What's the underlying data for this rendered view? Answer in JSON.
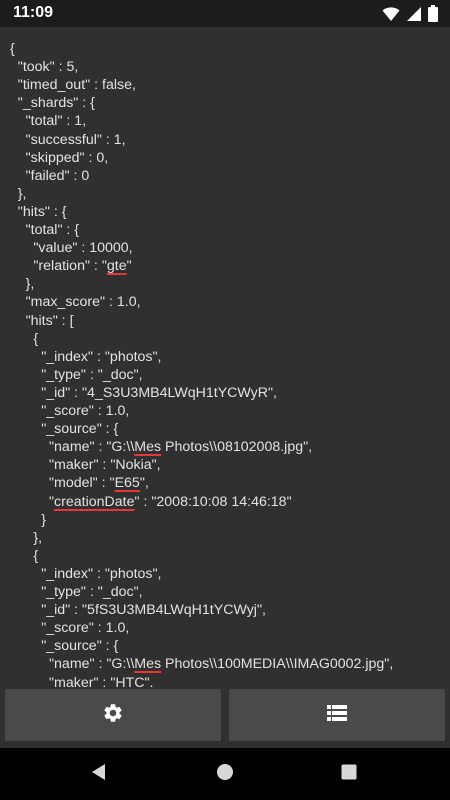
{
  "status": {
    "time": "11:09",
    "icons": [
      "wifi-icon",
      "signal-icon",
      "battery-icon"
    ]
  },
  "json_lines": [
    {
      "indent": 0,
      "parts": [
        {
          "t": "{"
        }
      ]
    },
    {
      "indent": 1,
      "parts": [
        {
          "t": "\"took\" : 5,"
        }
      ]
    },
    {
      "indent": 1,
      "parts": [
        {
          "t": "\"timed_out\" : false,"
        }
      ]
    },
    {
      "indent": 1,
      "parts": [
        {
          "t": "\"_shards\" : {"
        }
      ]
    },
    {
      "indent": 2,
      "parts": [
        {
          "t": "\"total\" : 1,"
        }
      ]
    },
    {
      "indent": 2,
      "parts": [
        {
          "t": "\"successful\" : 1,"
        }
      ]
    },
    {
      "indent": 2,
      "parts": [
        {
          "t": "\"skipped\" : 0,"
        }
      ]
    },
    {
      "indent": 2,
      "parts": [
        {
          "t": "\"failed\" : 0"
        }
      ]
    },
    {
      "indent": 1,
      "parts": [
        {
          "t": "},"
        }
      ]
    },
    {
      "indent": 1,
      "parts": [
        {
          "t": "\"hits\" : {"
        }
      ]
    },
    {
      "indent": 2,
      "parts": [
        {
          "t": "\"total\" : {"
        }
      ]
    },
    {
      "indent": 3,
      "parts": [
        {
          "t": "\"value\" : 10000,"
        }
      ]
    },
    {
      "indent": 3,
      "parts": [
        {
          "t": "\"relation\" : \""
        },
        {
          "t": "gte",
          "spell": true
        },
        {
          "t": "\""
        }
      ]
    },
    {
      "indent": 2,
      "parts": [
        {
          "t": "},"
        }
      ]
    },
    {
      "indent": 2,
      "parts": [
        {
          "t": "\"max_score\" : 1.0,"
        }
      ]
    },
    {
      "indent": 2,
      "parts": [
        {
          "t": "\"hits\" : ["
        }
      ]
    },
    {
      "indent": 3,
      "parts": [
        {
          "t": "{"
        }
      ]
    },
    {
      "indent": 4,
      "parts": [
        {
          "t": "\"_index\" : \"photos\","
        }
      ]
    },
    {
      "indent": 4,
      "parts": [
        {
          "t": "\"_type\" : \"_doc\","
        }
      ]
    },
    {
      "indent": 4,
      "parts": [
        {
          "t": "\"_id\" : \"4_S3U3MB4LWqH1tYCWyR\","
        }
      ]
    },
    {
      "indent": 4,
      "parts": [
        {
          "t": "\"_score\" : 1.0,"
        }
      ]
    },
    {
      "indent": 4,
      "parts": [
        {
          "t": "\"_source\" : {"
        }
      ]
    },
    {
      "indent": 5,
      "parts": [
        {
          "t": "\"name\" : \"G:\\\\"
        },
        {
          "t": "Mes",
          "spell": true
        },
        {
          "t": " Photos\\\\08102008.jpg\","
        }
      ]
    },
    {
      "indent": 5,
      "parts": [
        {
          "t": "\"maker\" : \"Nokia\","
        }
      ]
    },
    {
      "indent": 5,
      "parts": [
        {
          "t": "\"model\" : \""
        },
        {
          "t": "E65",
          "spell": true
        },
        {
          "t": "\","
        }
      ]
    },
    {
      "indent": 5,
      "parts": [
        {
          "t": "\""
        },
        {
          "t": "creationDate",
          "spell": true
        },
        {
          "t": "\" : \"2008:10:08 14:46:18\""
        }
      ]
    },
    {
      "indent": 4,
      "parts": [
        {
          "t": "}"
        }
      ]
    },
    {
      "indent": 3,
      "parts": [
        {
          "t": "},"
        }
      ]
    },
    {
      "indent": 3,
      "parts": [
        {
          "t": "{"
        }
      ]
    },
    {
      "indent": 4,
      "parts": [
        {
          "t": "\"_index\" : \"photos\","
        }
      ]
    },
    {
      "indent": 4,
      "parts": [
        {
          "t": "\"_type\" : \"_doc\","
        }
      ]
    },
    {
      "indent": 4,
      "parts": [
        {
          "t": "\"_id\" : \"5fS3U3MB4LWqH1tYCWyj\","
        }
      ]
    },
    {
      "indent": 4,
      "parts": [
        {
          "t": "\"_score\" : 1.0,"
        }
      ]
    },
    {
      "indent": 4,
      "parts": [
        {
          "t": "\"_source\" : {"
        }
      ]
    },
    {
      "indent": 5,
      "parts": [
        {
          "t": "\"name\" : \"G:\\\\"
        },
        {
          "t": "Mes",
          "spell": true
        },
        {
          "t": " Photos\\\\100MEDIA\\\\IMAG0002.jpg\","
        }
      ]
    },
    {
      "indent": 5,
      "parts": [
        {
          "t": "\"maker\" : \"HTC\","
        }
      ]
    }
  ],
  "buttons": {
    "settings_icon": "gear-icon",
    "list_icon": "list-icon"
  },
  "nav": {
    "back_icon": "back-triangle-icon",
    "home_icon": "home-circle-icon",
    "recents_icon": "recents-square-icon"
  },
  "colors": {
    "background": "#303030",
    "button": "#4a4a4a",
    "text": "#e2e2e2",
    "spellcheck": "#e53935"
  }
}
